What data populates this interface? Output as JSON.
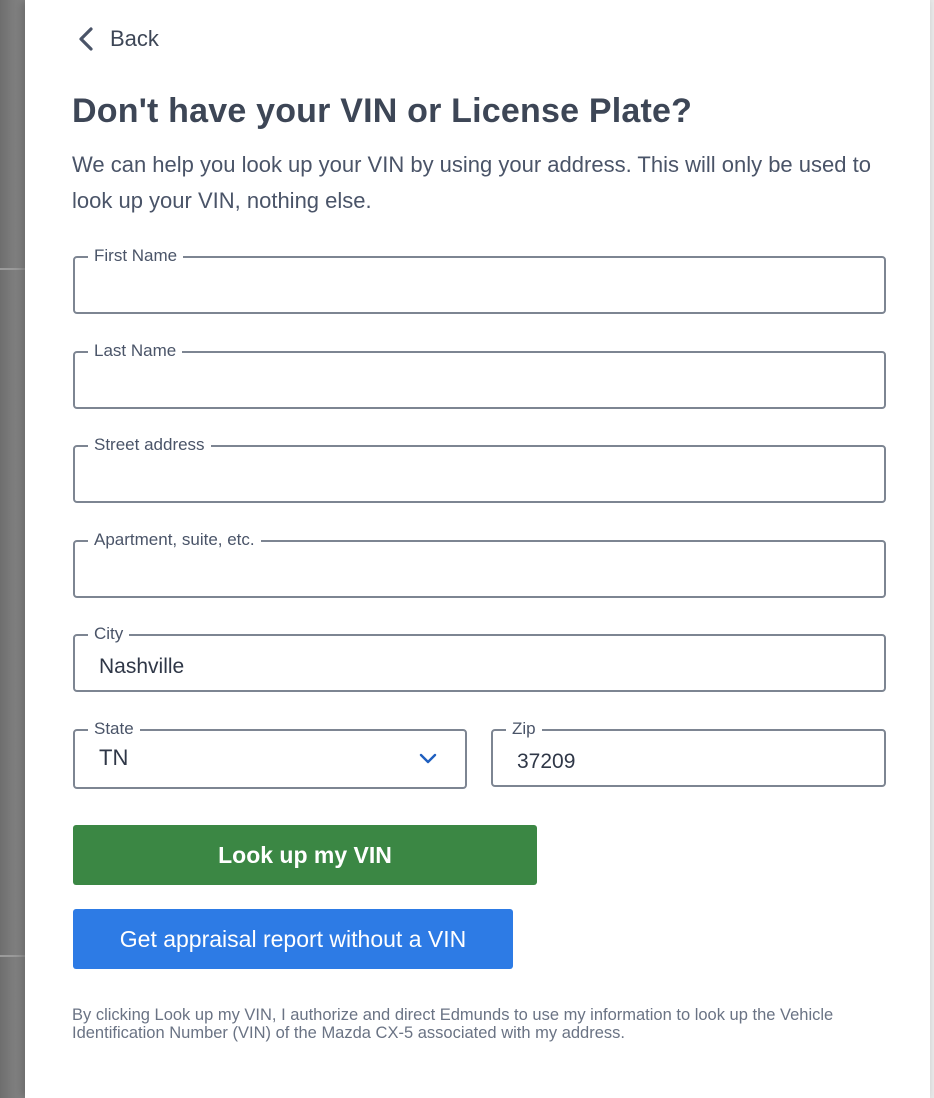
{
  "back": {
    "label": "Back"
  },
  "header": {
    "title": "Don't have your VIN or License Plate?",
    "subtitle": "We can help you look up your VIN by using your address. This will only be used to look up your VIN, nothing else."
  },
  "form": {
    "first_name": {
      "label": "First Name",
      "value": ""
    },
    "last_name": {
      "label": "Last Name",
      "value": ""
    },
    "street": {
      "label": "Street address",
      "value": ""
    },
    "apartment": {
      "label": "Apartment, suite, etc.",
      "value": ""
    },
    "city": {
      "label": "City",
      "value": "Nashville"
    },
    "state": {
      "label": "State",
      "value": "TN"
    },
    "zip": {
      "label": "Zip",
      "value": "37209"
    }
  },
  "actions": {
    "lookup_label": "Look up my VIN",
    "appraisal_label": "Get appraisal report without a VIN"
  },
  "disclaimer": "By clicking Look up my VIN, I authorize and direct Edmunds to use my information to look up the Vehicle Identification Number (VIN) of the Mazda CX-5 associated with my address.",
  "colors": {
    "primary_button": "#3b8744",
    "secondary_button": "#2d7be5",
    "heading_text": "#3d4656",
    "field_border": "#7d8592"
  },
  "icons": {
    "back": "chevron-left-icon",
    "state_select": "chevron-down-icon"
  }
}
